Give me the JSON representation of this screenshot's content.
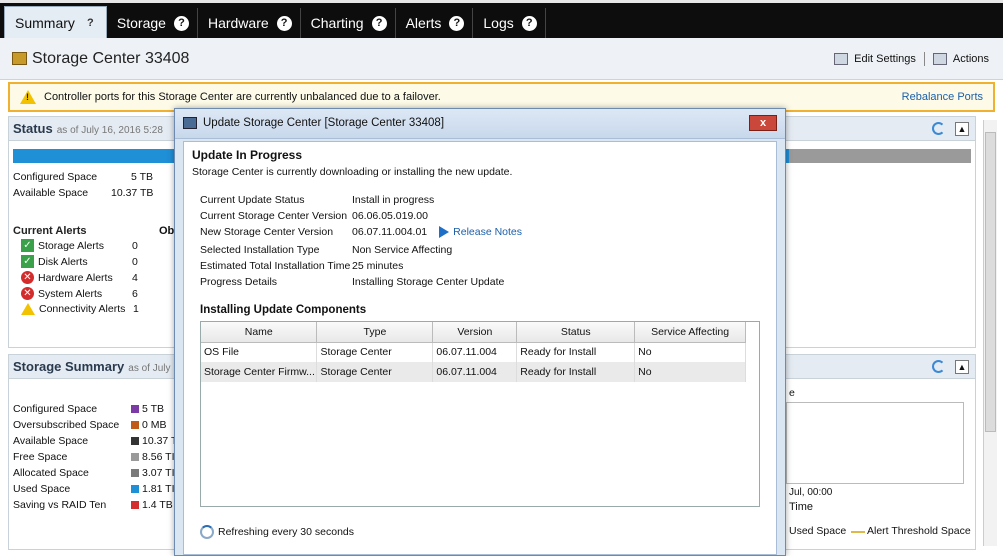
{
  "tabs": [
    {
      "label": "Summary",
      "active": true
    },
    {
      "label": "Storage",
      "active": false
    },
    {
      "label": "Hardware",
      "active": false
    },
    {
      "label": "Charting",
      "active": false
    },
    {
      "label": "Alerts",
      "active": false
    },
    {
      "label": "Logs",
      "active": false
    }
  ],
  "header": {
    "title": "Storage Center 33408",
    "edit_settings": "Edit Settings",
    "actions": "Actions"
  },
  "banner": {
    "message": "Controller ports for this Storage Center are currently unbalanced due to a failover.",
    "link": "Rebalance Ports"
  },
  "status_panel": {
    "title": "Status",
    "subtitle": "as of July 16, 2016 5:28",
    "configured_label": "Configured Space",
    "configured_value": "5 TB",
    "available_label": "Available Space",
    "available_value": "10.37 TB",
    "alerts_header": "Current Alerts",
    "col2_header": "Ob",
    "alerts": [
      {
        "label": "Storage Alerts",
        "count": "0",
        "icon": "check-icon"
      },
      {
        "label": "Disk Alerts",
        "count": "0",
        "icon": "check-icon"
      },
      {
        "label": "Hardware Alerts",
        "count": "4",
        "icon": "error-icon"
      },
      {
        "label": "System Alerts",
        "count": "6",
        "icon": "error-icon"
      },
      {
        "label": "Connectivity Alerts",
        "count": "1",
        "icon": "warning-icon"
      }
    ],
    "bar_color": "#1f8fd6"
  },
  "summary_panel": {
    "title": "Storage Summary",
    "subtitle": "as of July",
    "rows": [
      {
        "label": "Configured Space",
        "value": "5 TB",
        "color": "#7c3aa6"
      },
      {
        "label": "Oversubscribed Space",
        "value": "0 MB",
        "color": "#c05a18"
      },
      {
        "label": "Available Space",
        "value": "10.37 T",
        "color": "#333333"
      },
      {
        "label": "Free Space",
        "value": "8.56 TI",
        "color": "#9a9a9a"
      },
      {
        "label": "Allocated Space",
        "value": "3.07 TI",
        "color": "#7a7a7a"
      },
      {
        "label": "Used Space",
        "value": "1.81 TI",
        "color": "#1f8fd6"
      },
      {
        "label": "Saving vs RAID Ten",
        "value": "1.4 TB",
        "color": "#d42d2d"
      }
    ],
    "chart_fragment": "e",
    "chart_tick": "Jul, 00:00",
    "chart_xlabel": "Time",
    "legend_used": "Used Space",
    "legend_threshold": "Alert Threshold Space"
  },
  "dialog": {
    "title": "Update Storage Center [Storage Center 33408]",
    "close": "x",
    "heading": "Update In Progress",
    "description": "Storage Center is currently downloading or installing the new update.",
    "info": [
      {
        "label": "Current Update Status",
        "value": "Install in progress"
      },
      {
        "label": "Current Storage Center Version",
        "value": "06.06.05.019.00"
      },
      {
        "label": "New Storage Center Version",
        "value": "06.07.11.004.01"
      },
      {
        "label": "Selected Installation Type",
        "value": "Non Service Affecting"
      },
      {
        "label": "Estimated Total Installation Time",
        "value": "25 minutes"
      },
      {
        "label": "Progress Details",
        "value": "Installing Storage Center Update"
      }
    ],
    "release_notes": "Release Notes",
    "components_heading": "Installing Update Components",
    "columns": [
      "Name",
      "Type",
      "Version",
      "Status",
      "Service Affecting"
    ],
    "rows": [
      [
        "OS File",
        "Storage Center",
        "06.07.11.004",
        "Ready for Install",
        "No"
      ],
      [
        "Storage Center Firmw...",
        "Storage Center",
        "06.07.11.004",
        "Ready for Install",
        "No"
      ]
    ],
    "refresh_text": "Refreshing every 30 seconds"
  }
}
